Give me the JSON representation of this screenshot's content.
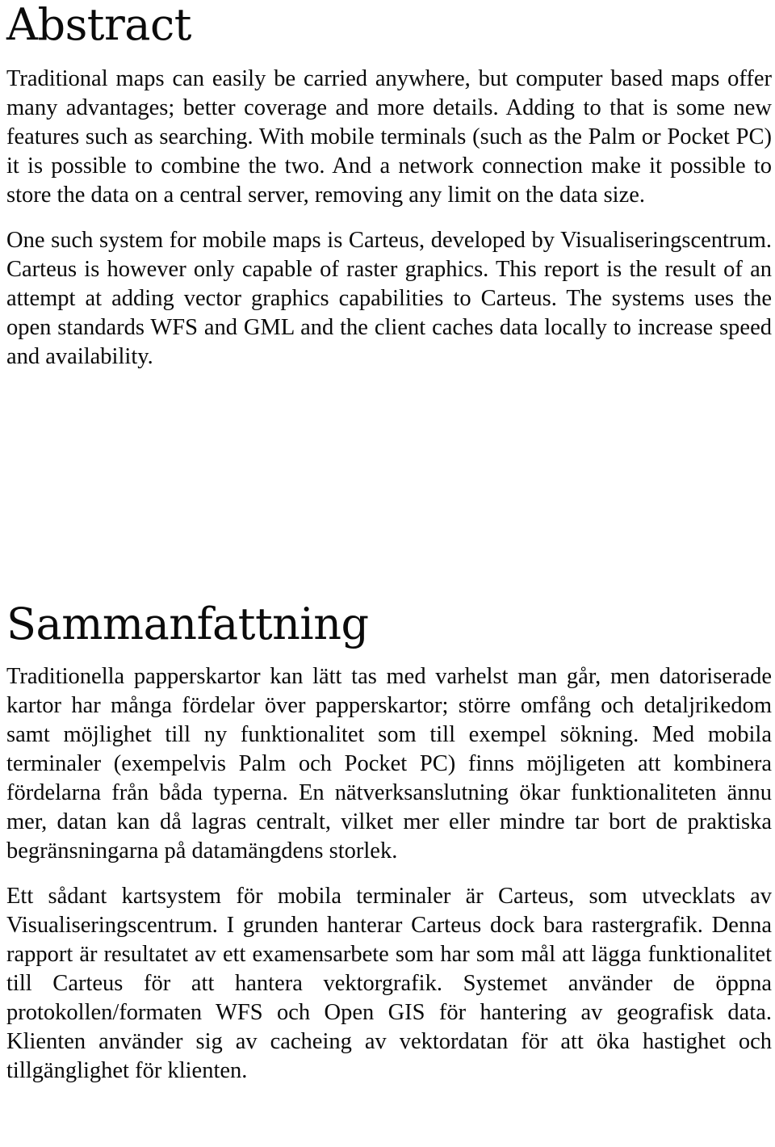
{
  "document": {
    "background_color": "#ffffff",
    "text_color": "#000000",
    "sections": [
      {
        "id": "abstract",
        "heading": "Abstract",
        "language": "en"
      },
      {
        "id": "sammanfattning",
        "heading": "Sammanfattning",
        "language": "sv"
      }
    ]
  },
  "abstract": {
    "heading": "Abstract",
    "paragraphs": [
      "Traditional maps can easily be carried anywhere, but computer based maps offer many advantages; better coverage and more details. Adding to that is some new features such as searching. With mobile terminals (such as the Palm or Pocket PC) it is possible to combine the two. And a network connection make it possible to store the data on a central server, removing any limit on the data size.",
      "One such system for mobile maps is Carteus, developed by Visualiseringscentrum. Carteus is however only capable of raster graphics. This report is the result of an attempt at adding vector graphics capabilities to Carteus. The systems uses the open standards WFS and GML and the client caches data locally to increase speed and availability."
    ]
  },
  "sammanfattning": {
    "heading": "Sammanfattning",
    "paragraphs": [
      "Traditionella papperskartor kan lätt tas med varhelst man går, men datoriserade kartor har många fördelar över papperskartor; större omfång och detaljrikedom samt möjlighet till ny funktionalitet som till exempel sökning. Med mobila terminaler (exempelvis Palm och Pocket PC) finns möjligeten att kombinera fördelarna från båda typerna. En nätverksanslutning ökar funktionaliteten ännu mer, datan kan då lagras centralt, vilket mer eller mindre tar bort de praktiska begränsningarna på datamängdens storlek.",
      "Ett sådant kartsystem för mobila terminaler är Carteus, som utvecklats av Visualiseringscentrum. I grunden hanterar Carteus dock bara rastergrafik. Denna rapport är resultatet av ett examensarbete som har som mål att lägga funktionalitet till Carteus för att hantera vektorgrafik. Systemet använder de öppna protokollen/formaten WFS och Open GIS för hantering av geografisk data. Klienten använder sig av cacheing av vektordatan för att öka hastighet och tillgänglighet för klienten."
    ]
  }
}
